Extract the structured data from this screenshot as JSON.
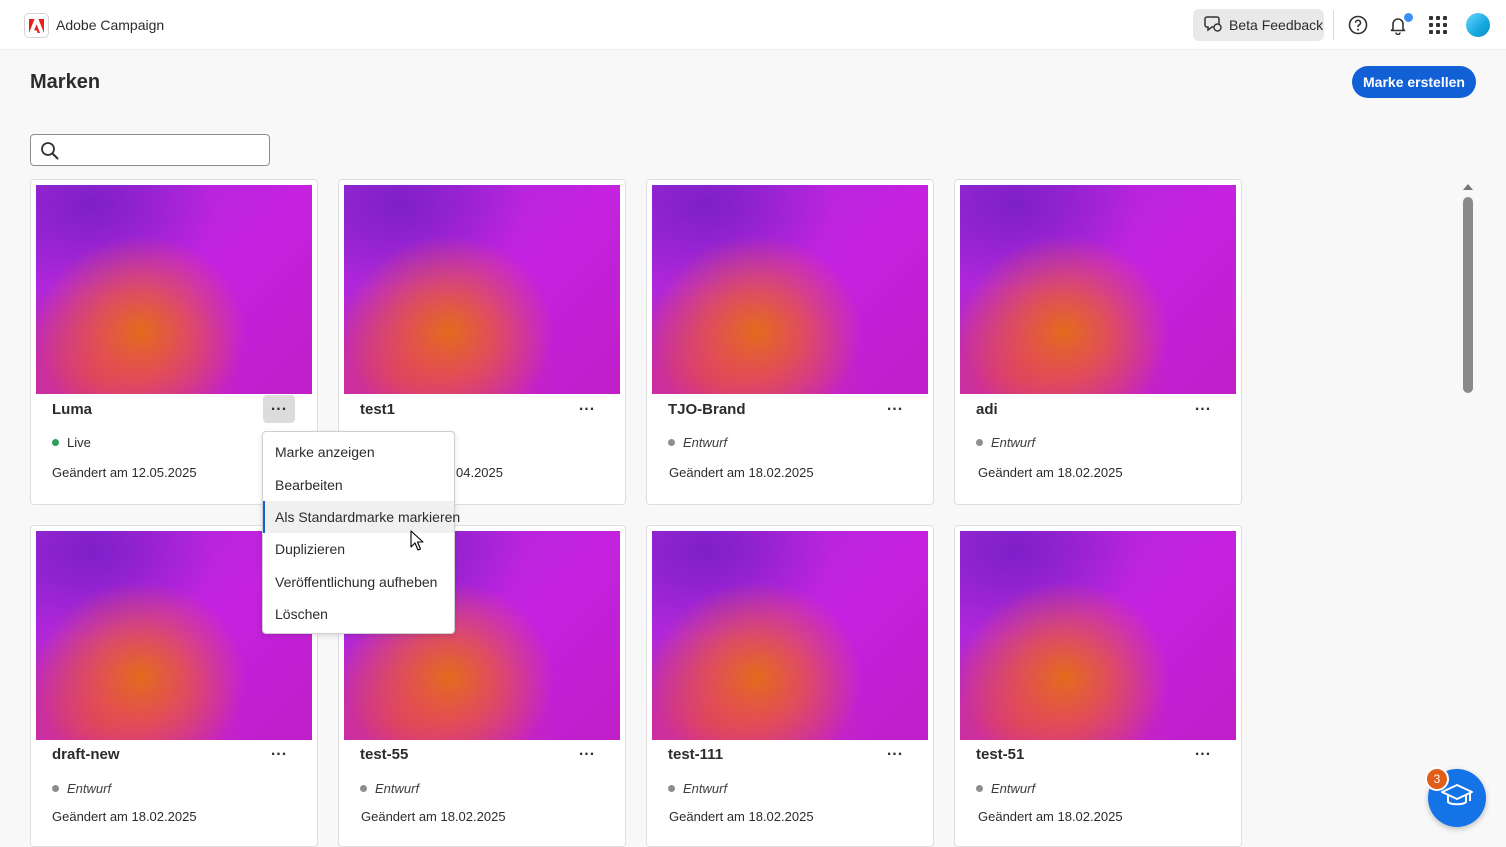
{
  "app": {
    "name": "Adobe Campaign",
    "beta_feedback_label": "Beta Feedback"
  },
  "page": {
    "title": "Marken",
    "create_button_label": "Marke erstellen"
  },
  "search": {
    "value": "",
    "placeholder": ""
  },
  "cards": [
    {
      "name": "Luma",
      "status": "Live",
      "modified": "Geändert am 12.05.2025"
    },
    {
      "name": "test1",
      "status": "",
      "modified": "04.2025"
    },
    {
      "name": "TJO-Brand",
      "status": "Entwurf",
      "modified": "Geändert am 18.02.2025"
    },
    {
      "name": "adi",
      "status": "Entwurf",
      "modified": "Geändert am 18.02.2025"
    },
    {
      "name": "draft-new",
      "status": "Entwurf",
      "modified": "Geändert am 18.02.2025"
    },
    {
      "name": "test-55",
      "status": "Entwurf",
      "modified": "Geändert am 18.02.2025"
    },
    {
      "name": "test-111",
      "status": "Entwurf",
      "modified": "Geändert am 18.02.2025"
    },
    {
      "name": "test-51",
      "status": "Entwurf",
      "modified": "Geändert am 18.02.2025"
    }
  ],
  "context_menu": {
    "items": [
      "Marke anzeigen",
      "Bearbeiten",
      "Als Standardmarke markieren",
      "Duplizieren",
      "Veröffentlichung aufheben",
      "Löschen"
    ],
    "hovered_index": 2
  },
  "learn": {
    "badge_count": "3"
  },
  "colors": {
    "accent": "#1160d6",
    "live": "#2e9d5c",
    "draft": "#8e8e8e",
    "badge": "#e25e18"
  }
}
